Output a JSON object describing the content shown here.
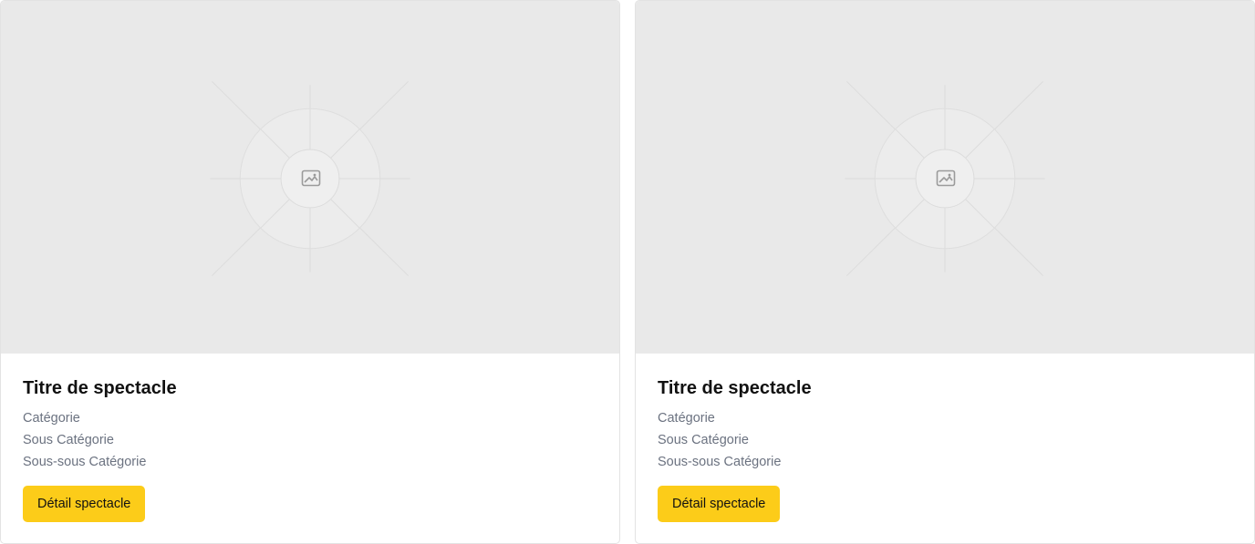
{
  "cards": [
    {
      "image_icon": "image-icon",
      "title": "Titre de spectacle",
      "category": "Catégorie",
      "subcategory": "Sous Catégorie",
      "subsubcategory": "Sous-sous Catégorie",
      "button_label": "Détail spectacle"
    },
    {
      "image_icon": "image-icon",
      "title": "Titre de spectacle",
      "category": "Catégorie",
      "subcategory": "Sous Catégorie",
      "subsubcategory": "Sous-sous Catégorie",
      "button_label": "Détail spectacle"
    }
  ],
  "colors": {
    "accent": "#fccc19",
    "placeholder_bg": "#e9e9e9",
    "muted_text": "#6b7280",
    "title_text": "#111111"
  }
}
